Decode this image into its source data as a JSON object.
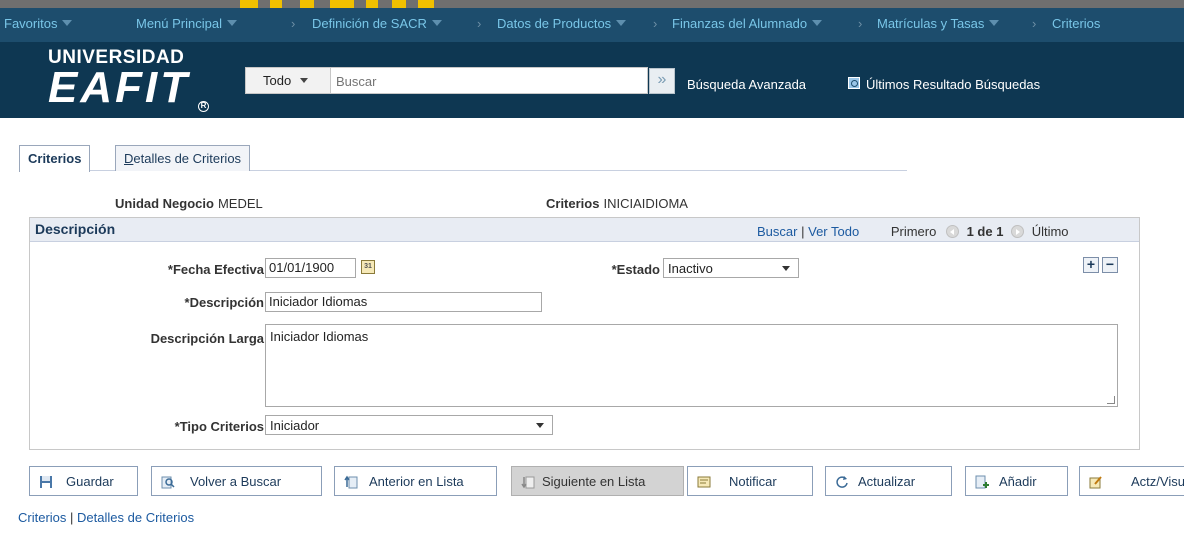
{
  "nav": {
    "items": [
      "Favoritos",
      "Menú Principal",
      "Definición de SACR",
      "Datos de Productos",
      "Finanzas del Alumnado",
      "Matrículas y Tasas",
      "Criterios"
    ]
  },
  "header": {
    "logo_line1": "UNIVERSIDAD",
    "logo_line2": "EAFIT",
    "logo_reg": "R",
    "search_scope": "Todo",
    "search_placeholder": "Buscar",
    "advanced_search": "Búsqueda Avanzada",
    "recent_search": "Últimos Resultado Búsquedas"
  },
  "tabs": [
    {
      "label": "Criterios",
      "active": true
    },
    {
      "label_pre": "D",
      "label_rest": "etalles de Criterios",
      "active": false
    }
  ],
  "info": {
    "unidad_label": "Unidad Negocio",
    "unidad_value": "MEDEL",
    "criterios_label": "Criterios",
    "criterios_value": "INICIAIDIOMA"
  },
  "panel": {
    "title": "Descripción",
    "buscar": "Buscar",
    "pipe": "|",
    "ver_todo": "Ver Todo",
    "primero": "Primero",
    "count": "1 de 1",
    "ultimo": "Último"
  },
  "form": {
    "fecha_label": "*Fecha Efectiva",
    "fecha_value": "01/01/1900",
    "cal_text": "31",
    "estado_label": "*Estado",
    "estado_value": "Inactivo",
    "descripcion_label": "*Descripción",
    "descripcion_value": "Iniciador Idiomas",
    "desc_larga_label": "Descripción Larga",
    "desc_larga_value": "Iniciador Idiomas",
    "tipo_label": "*Tipo Criterios",
    "tipo_value": "Iniciador",
    "add": "+",
    "remove": "−"
  },
  "buttons": {
    "guardar": "Guardar",
    "volver": "Volver a Buscar",
    "anterior": "Anterior en Lista",
    "siguiente": "Siguiente en Lista",
    "notificar": "Notificar",
    "actualizar": "Actualizar",
    "anadir": "Añadir",
    "actz": "Actz/Visualizar"
  },
  "footer": {
    "link1": "Criterios",
    "pipe": "|",
    "link2": "Detalles de Criterios"
  },
  "colors": {
    "nav_bg": "#1d4d6d",
    "header_bg": "#0e3752",
    "nav_link": "#79c6e8",
    "link": "#1c5aa0"
  }
}
